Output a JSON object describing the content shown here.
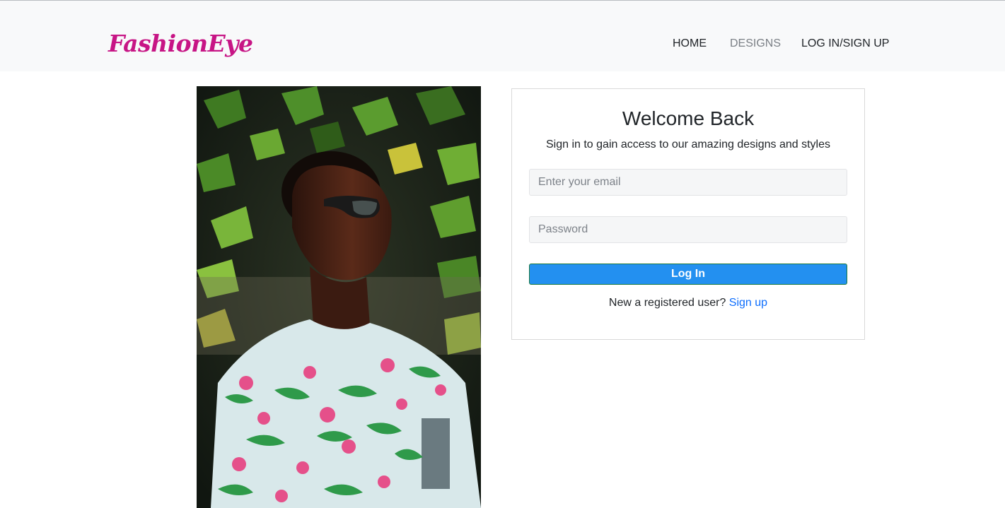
{
  "navbar": {
    "brand": "FashionEye",
    "links": [
      {
        "label": "HOME",
        "active": true
      },
      {
        "label": "DESIGNS",
        "active": false
      },
      {
        "label": "LOG IN/SIGN UP",
        "active": true
      }
    ]
  },
  "hero_image": {
    "alt": "Man in sunglasses and floral shirt"
  },
  "login_card": {
    "title": "Welcome Back",
    "subtitle": "Sign in to gain access to our amazing designs and styles",
    "email": {
      "placeholder": "Enter your email",
      "value": ""
    },
    "password": {
      "placeholder": "Password",
      "value": ""
    },
    "submit_label": "Log In",
    "signup_prompt": "New a registered user?",
    "signup_link": "Sign up"
  },
  "colors": {
    "brand": "#c71585",
    "navbar_bg": "#f8f9fa",
    "button": "#2390f0",
    "link": "#0d6efd",
    "inactive_nav": "#7a7f85"
  }
}
